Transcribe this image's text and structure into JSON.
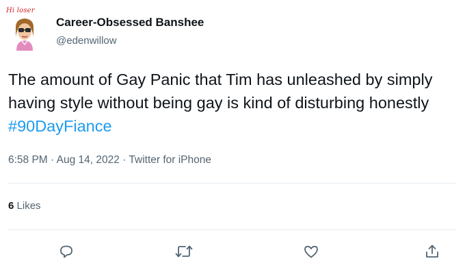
{
  "avatar": {
    "caption": "Hi loser",
    "icon": "bitmoji-avatar-icon"
  },
  "author": {
    "display_name": "Career-Obsessed Banshee",
    "handle": "@edenwillow"
  },
  "tweet": {
    "text_part1": "The amount of Gay Panic that Tim has unleashed by simply having style without being gay is kind of disturbing honestly ",
    "hashtag": "#90DayFiance"
  },
  "meta": {
    "time": "6:58 PM",
    "separator1": " · ",
    "date": "Aug 14, 2022",
    "separator2": " · ",
    "source": "Twitter for iPhone"
  },
  "engagement": {
    "likes_count": "6",
    "likes_label": "Likes"
  },
  "actions": [
    {
      "name": "reply",
      "icon": "reply-icon"
    },
    {
      "name": "retweet",
      "icon": "retweet-icon"
    },
    {
      "name": "like",
      "icon": "heart-icon"
    },
    {
      "name": "share",
      "icon": "share-icon"
    }
  ],
  "colors": {
    "text": "#0f1419",
    "secondary": "#536471",
    "link": "#1d9bf0",
    "divider": "#e6ecf0"
  }
}
